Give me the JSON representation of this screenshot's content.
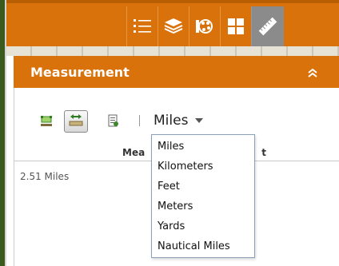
{
  "panel": {
    "title": "Measurement"
  },
  "units": {
    "selected": "Miles",
    "options": [
      "Miles",
      "Kilometers",
      "Feet",
      "Meters",
      "Yards",
      "Nautical Miles"
    ]
  },
  "results": {
    "column_header_left": "Mea",
    "column_header_right": "t",
    "value": "2.51 Miles"
  },
  "toolbar": {
    "icons": [
      "legend-icon",
      "layers-icon",
      "basemap-gallery-icon",
      "grid-icon",
      "ruler-icon"
    ]
  },
  "colors": {
    "accent": "#d9720b",
    "frame": "#3d5a1e",
    "active_tool": "#8b8b8b"
  }
}
